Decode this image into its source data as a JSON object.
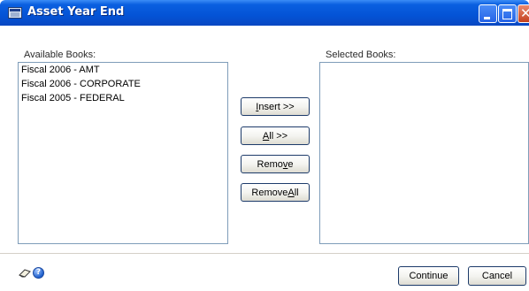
{
  "window": {
    "title": "Asset Year End"
  },
  "available": {
    "label": "Available Books:",
    "items": [
      "Fiscal 2006 - AMT",
      "Fiscal 2006 - CORPORATE",
      "Fiscal 2005 - FEDERAL"
    ]
  },
  "selected": {
    "label": "Selected Books:",
    "items": []
  },
  "actions": {
    "insert": {
      "label": "Insert >>",
      "mnemonic": "I"
    },
    "all": {
      "label": "All >>",
      "mnemonic": "A"
    },
    "remove": {
      "label": "Remove",
      "mnemonic": "v"
    },
    "remove_all": {
      "label": "Remove All",
      "mnemonic": "A"
    }
  },
  "footer": {
    "continue_label": "Continue",
    "cancel_label": "Cancel",
    "icons": [
      "note-icon",
      "help-icon"
    ]
  }
}
